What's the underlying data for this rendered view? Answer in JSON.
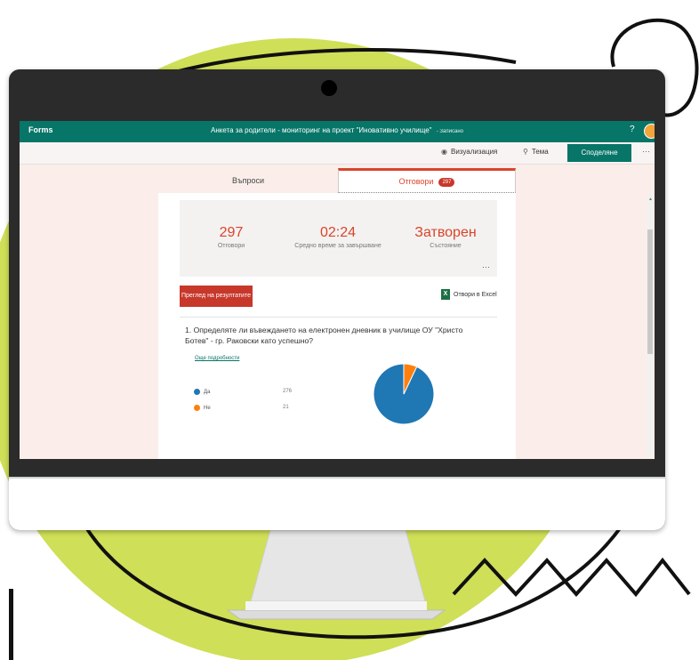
{
  "app": {
    "brand": "Forms",
    "title": "Анкета за родители - мониторинг на проект \"Иновативно училище\"",
    "saved_status": "- Записано",
    "help": "?"
  },
  "toolbar": {
    "preview_label": "Визуализация",
    "preview_icon": "eye-icon",
    "theme_label": "Тема",
    "theme_icon": "palette-icon",
    "share_label": "Споделяне",
    "more": "···"
  },
  "tabs": [
    {
      "label": "Въпроси"
    },
    {
      "label": "Отговори",
      "badge": "297",
      "active": true
    }
  ],
  "summary": {
    "responses": {
      "value": "297",
      "label": "Отговори"
    },
    "avg_time": {
      "value": "02:24",
      "label": "Средно време за завършване"
    },
    "status": {
      "value": "Затворен",
      "label": "Състояние"
    },
    "more": "···"
  },
  "actions": {
    "view_results": "Преглед на резултатите",
    "open_excel": "Отвори в Excel",
    "excel_glyph": "X"
  },
  "question": {
    "number": "1.",
    "text": "Определяте ли въвеждането на електронен дневник в училище ОУ \"Христо Ботев\" - гр. Раковски като успешно?",
    "more_details": "Още подробности",
    "options": [
      {
        "label": "Да",
        "count": "276",
        "color": "#1f77b4"
      },
      {
        "label": "Не",
        "count": "21",
        "color": "#ff7f0e"
      }
    ]
  },
  "chart_data": {
    "type": "pie",
    "categories": [
      "Да",
      "Не"
    ],
    "values": [
      276,
      21
    ],
    "colors": [
      "#1f77b4",
      "#ff7f0e"
    ]
  },
  "colors": {
    "brand": "#077568",
    "accent": "#d9442b",
    "decor_green": "#cfdf57"
  }
}
